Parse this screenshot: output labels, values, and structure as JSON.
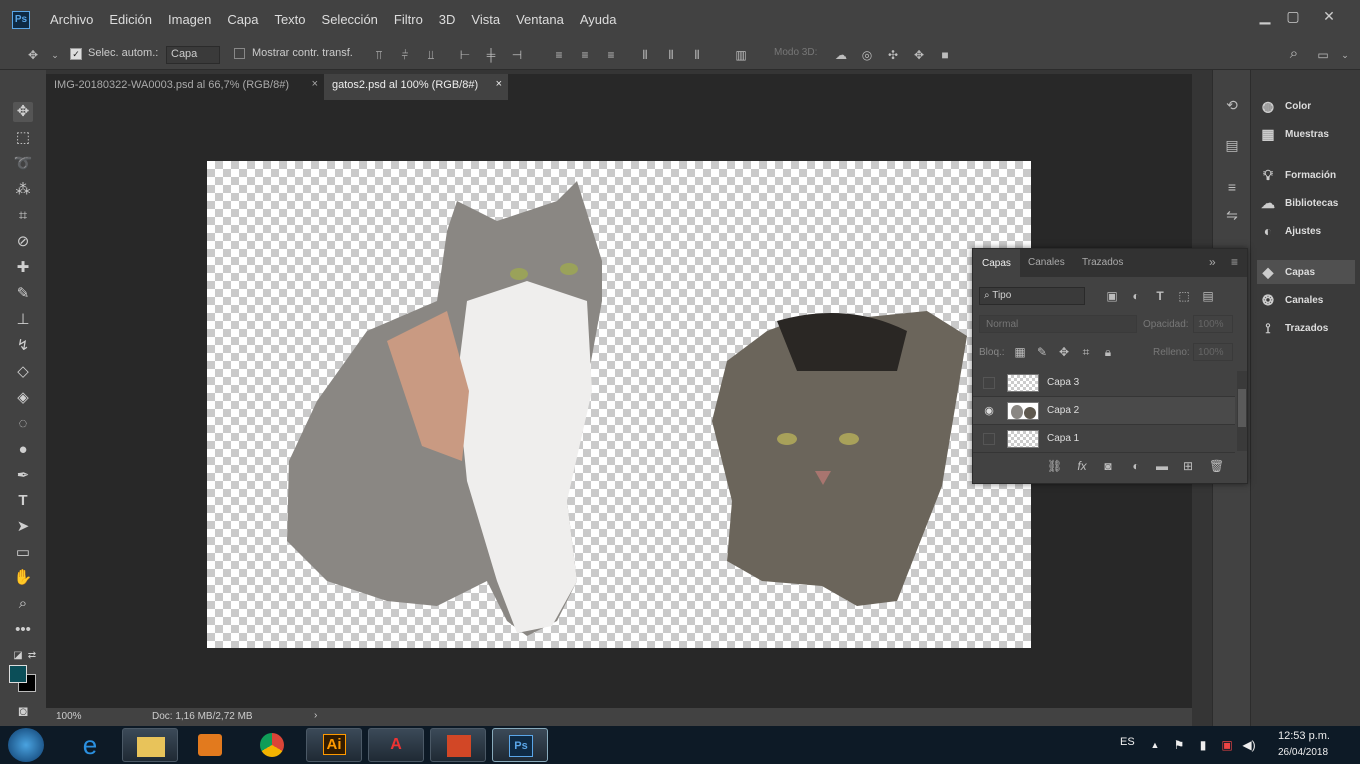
{
  "app": {
    "logo": "Ps",
    "menu": [
      "Archivo",
      "Edición",
      "Imagen",
      "Capa",
      "Texto",
      "Selección",
      "Filtro",
      "3D",
      "Vista",
      "Ventana",
      "Ayuda"
    ]
  },
  "options": {
    "auto_select_label": "Selec. autom.:",
    "auto_select_value": "Capa",
    "show_transform_label": "Mostrar contr. transf.",
    "mode3d_label": "Modo 3D:"
  },
  "tabs": [
    {
      "label": "IMG-20180322-WA0003.psd al 66,7% (RGB/8#)",
      "close": "×"
    },
    {
      "label": "gatos2.psd al 100% (RGB/8#)",
      "close": "×"
    }
  ],
  "status": {
    "zoom": "100%",
    "doc": "Doc: 1,16 MB/2,72 MB",
    "arrow": "›"
  },
  "right_panel": {
    "items": [
      "Color",
      "Muestras",
      "Formación",
      "Bibliotecas",
      "Ajustes",
      "Capas",
      "Canales",
      "Trazados"
    ]
  },
  "layers_panel": {
    "tabs": [
      "Capas",
      "Canales",
      "Trazados"
    ],
    "filter": "Tipo",
    "blend": "Normal",
    "opacity_label": "Opacidad:",
    "opacity": "100%",
    "lock_label": "Bloq.:",
    "fill_label": "Relleno:",
    "fill": "100%",
    "layers": [
      {
        "name": "Capa 3",
        "visible": false
      },
      {
        "name": "Capa 2",
        "visible": true
      },
      {
        "name": "Capa 1",
        "visible": false
      }
    ],
    "footer_fx": "fx"
  },
  "taskbar": {
    "lang": "ES",
    "time": "12:53 p.m.",
    "date": "26/04/2018"
  }
}
